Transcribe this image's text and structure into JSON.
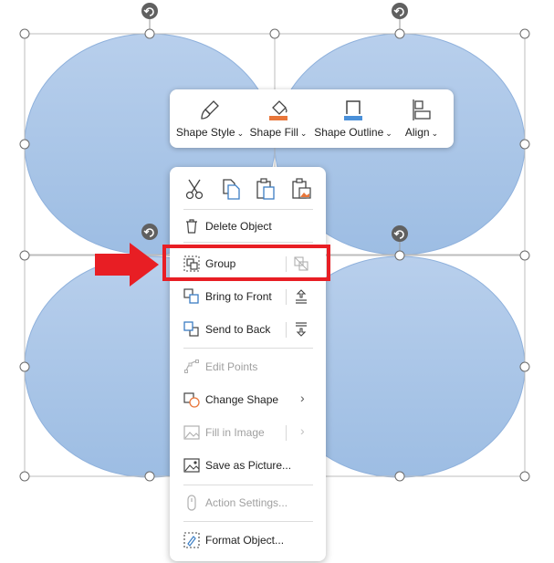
{
  "colors": {
    "shape_fill_top": "#b8cfec",
    "shape_fill_bottom": "#9dbde3",
    "shape_stroke": "#8fb1dc",
    "handle_stroke": "#6b6b6b",
    "rotate_handle": "#606060",
    "accent_fill": "#e8763a",
    "accent_outline": "#4a90d9",
    "highlight_red": "#e81e24"
  },
  "toolbar": {
    "items": [
      {
        "label": "Shape Style",
        "icon": "brush-icon"
      },
      {
        "label": "Shape Fill",
        "icon": "paint-bucket-icon"
      },
      {
        "label": "Shape Outline",
        "icon": "shape-outline-icon"
      },
      {
        "label": "Align",
        "icon": "align-icon"
      }
    ],
    "chevron": "⌄"
  },
  "menu": {
    "clipboard_icons": [
      "cut-icon",
      "copy-icon",
      "paste-icon",
      "paste-picture-icon"
    ],
    "items": [
      {
        "label": "Delete Object",
        "icon": "trash-icon",
        "enabled": true
      },
      {
        "label": "Group",
        "icon": "group-icon",
        "enabled": true,
        "side_icon": "ungroup-icon"
      },
      {
        "label": "Bring to Front",
        "icon": "bring-to-front-icon",
        "enabled": true,
        "side_icon": "bring-forward-icon"
      },
      {
        "label": "Send to Back",
        "icon": "send-to-back-icon",
        "enabled": true,
        "side_icon": "send-backward-icon"
      },
      {
        "label": "Edit Points",
        "icon": "edit-points-icon",
        "enabled": false
      },
      {
        "label": "Change Shape",
        "icon": "change-shape-icon",
        "enabled": true,
        "submenu": true
      },
      {
        "label": "Fill in Image",
        "icon": "fill-image-icon",
        "enabled": false,
        "submenu": true
      },
      {
        "label": "Save as Picture...",
        "icon": "save-picture-icon",
        "enabled": true
      },
      {
        "label": "Action Settings...",
        "icon": "action-settings-icon",
        "enabled": false
      },
      {
        "label": "Format Object...",
        "icon": "format-object-icon",
        "enabled": true
      }
    ],
    "submenu_arrow": "›"
  },
  "annotation": {
    "highlighted_item": "Group"
  }
}
